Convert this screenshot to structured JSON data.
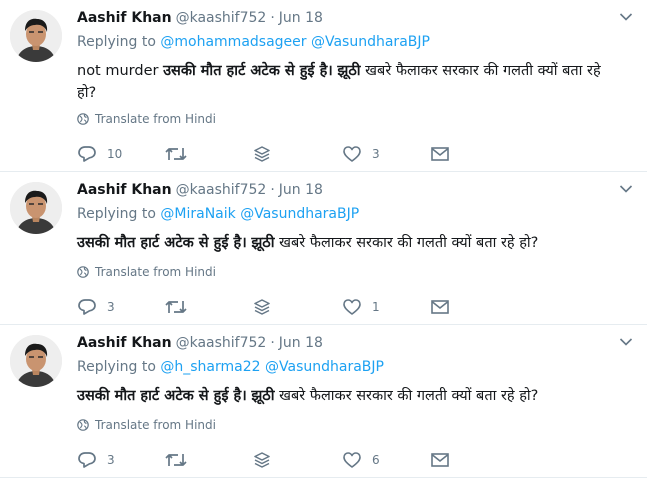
{
  "tweets": [
    {
      "name": "Aashif Khan",
      "handle": "@kaashif752",
      "date": "Jun 18",
      "replying_to": "Replying to",
      "mention1": "@mohammadsageer",
      "mention2": "@VasundharaBJP",
      "text_plain_prefix": "not murder ",
      "text_bold_1": "उसकी मौत हार्ट अटेक से हुई है।",
      "text_mid": " ",
      "text_bold_2": "झूठी",
      "text_rest": " खबरे फैलाकर सरकार की गलती क्यों बता रहे हो?",
      "translate": "Translate from Hindi",
      "replies": "10",
      "retweets": "",
      "likes": "3"
    },
    {
      "name": "Aashif Khan",
      "handle": "@kaashif752",
      "date": "Jun 18",
      "replying_to": "Replying to",
      "mention1": "@MiraNaik",
      "mention2": "@VasundharaBJP",
      "text_plain_prefix": "",
      "text_bold_1": "उसकी मौत हार्ट अटेक से हुई है।",
      "text_mid": " ",
      "text_bold_2": "झूठी",
      "text_rest": " खबरे फैलाकर सरकार की गलती क्यों बता रहे हो?",
      "translate": "Translate from Hindi",
      "replies": "3",
      "retweets": "",
      "likes": "1"
    },
    {
      "name": "Aashif Khan",
      "handle": "@kaashif752",
      "date": "Jun 18",
      "replying_to": "Replying to",
      "mention1": "@h_sharma22",
      "mention2": "@VasundharaBJP",
      "text_plain_prefix": "",
      "text_bold_1": "उसकी मौत हार्ट अटेक से हुई है।",
      "text_mid": " ",
      "text_bold_2": "झूठी",
      "text_rest": " खबरे फैलाकर सरकार की गलती क्यों बता रहे हो?",
      "translate": "Translate from Hindi",
      "replies": "3",
      "retweets": "",
      "likes": "6"
    }
  ],
  "colors": {
    "link": "#1da1f2",
    "muted": "#657786",
    "divider": "#e6ecf0"
  },
  "icons": [
    "chevron-down-icon",
    "globe-icon",
    "reply-icon",
    "retweet-icon",
    "stack-icon",
    "heart-icon",
    "mail-icon"
  ]
}
